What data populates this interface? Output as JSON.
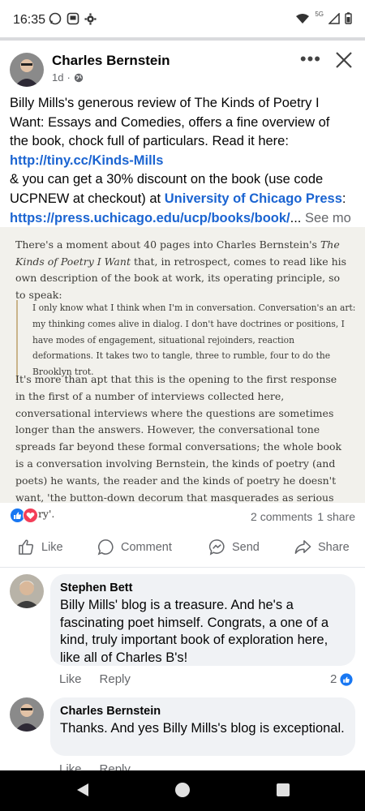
{
  "status_bar": {
    "time": "16:35",
    "network": "5G",
    "left_icons": [
      "whatsapp-icon",
      "app-icon",
      "settings-icon"
    ],
    "right_icons": [
      "wifi-icon",
      "signal-icon",
      "battery-icon"
    ]
  },
  "post": {
    "author": "Charles Bernstein",
    "time": "1d",
    "audience_icon": "globe-icon",
    "text_segments": [
      {
        "type": "text",
        "value": "Billy Mills's generous review of The Kinds of Poetry I"
      },
      {
        "type": "text",
        "value": "Want: Essays and Comedies, offers a fine overview of"
      },
      {
        "type": "text",
        "value": "the book, chock full of particulars. Read it here:"
      },
      {
        "type": "link",
        "value": "http://tiny.cc/Kinds-Mills"
      },
      {
        "type": "text",
        "value": "& you can get a 30% discount on the book (use code"
      },
      {
        "type": "text",
        "value": "UCPNEW at checkout) at "
      },
      {
        "type": "link",
        "value": "University of Chicago Press"
      },
      {
        "type": "text",
        "value": ":"
      },
      {
        "type": "link",
        "value": "https://press.uchicago.edu/ucp/books/book/"
      },
      {
        "type": "text",
        "value": "..."
      },
      {
        "type": "more",
        "value": "See mo"
      }
    ]
  },
  "article": {
    "para1_prefix": "There's a moment about 40 pages into Charles Bernstein's ",
    "para1_title": "The Kinds of Poetry I Want",
    "para1_suffix": " that, in retrospect, comes to read like his own description of the book at work, its operating principle, so to speak:",
    "quote": "I only know what I think when I'm in conversation. Conversation's an art: my thinking comes alive in dialog. I don't have doctrines or positions, I have modes of engagement, situational rejoinders, reaction deformations. It takes two to tangle, three to rumble, four to do the Brooklyn trot.",
    "para2": "It's more than apt that this is the opening to the first response in the first of a number of interviews collected here, conversational interviews where the questions are sometimes longer than the answers. However, the conversational tone spreads far beyond these formal conversations; the whole book is a conversation involving Bernstein, the kinds of poetry (and poets) he wants, the reader and the kinds of poetry he doesn't want, 'the button-down decorum that masquerades as serious poetry'."
  },
  "stats": {
    "comments": "2 comments",
    "shares": "1 share"
  },
  "actions": {
    "like": "Like",
    "comment": "Comment",
    "send": "Send",
    "share": "Share"
  },
  "comments": [
    {
      "author": "Stephen Bett",
      "text": "Billy Mills' blog is a treasure. And he's a fascinating poet himself. Congrats, a one of a kind, truly important book of exploration here, like all of Charles B's!",
      "like": "Like",
      "reply": "Reply",
      "likes": "2"
    },
    {
      "author": "Charles Bernstein",
      "text": "Thanks. And yes Billy Mills's blog is exceptional.",
      "like": "Like",
      "reply": "Reply"
    }
  ],
  "colors": {
    "link": "#1b64d1",
    "meta": "#65676b",
    "article_bg": "#f2f1ec",
    "bubble_bg": "#f0f2f5"
  }
}
